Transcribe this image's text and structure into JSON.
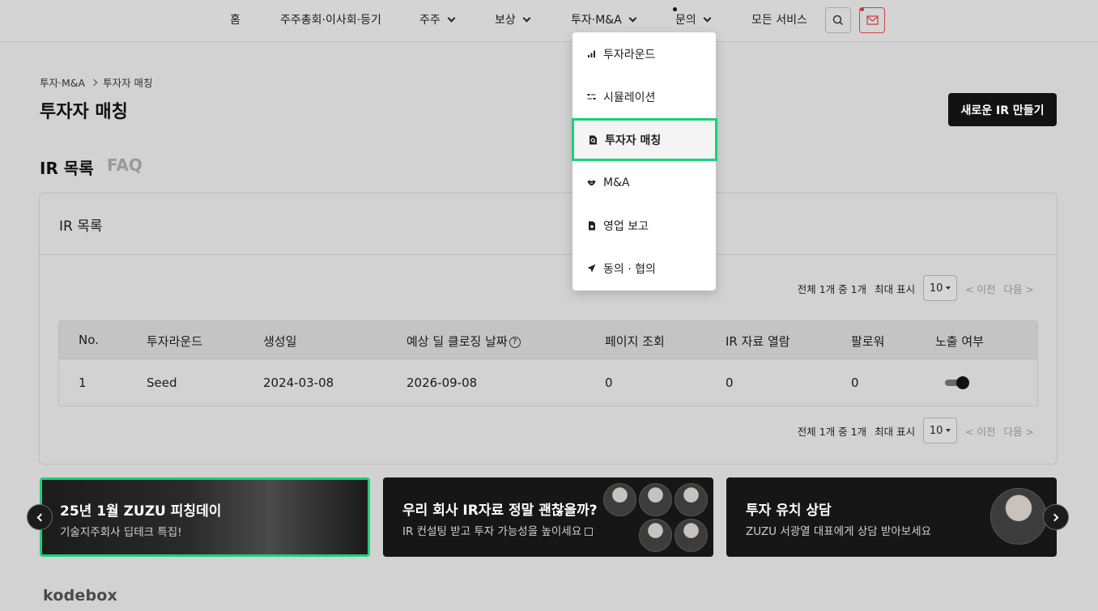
{
  "nav": {
    "items": [
      {
        "label": "홈"
      },
      {
        "label": "주주총회·이사회·등기"
      },
      {
        "label": "주주"
      },
      {
        "label": "보상"
      },
      {
        "label": "투자·M&A"
      },
      {
        "label": "문의"
      },
      {
        "label": "모든 서비스"
      }
    ],
    "search_icon": "search-icon",
    "mail_icon": "mail-icon"
  },
  "breadcrumb": {
    "parent": "투자·M&A",
    "current": "투자자 매칭"
  },
  "page_title": "투자자 매칭",
  "primary_button": "새로운 IR 만들기",
  "tabs": [
    {
      "label": "IR 목록"
    },
    {
      "label": "FAQ"
    }
  ],
  "card": {
    "title": "IR 목록",
    "pagination": {
      "summary": "전체 1개 중 1개",
      "max_label": "최대 표시",
      "page_size": "10",
      "prev": "< 이전",
      "next": "다음 >"
    },
    "table": {
      "columns": [
        "No.",
        "투자라운드",
        "생성일",
        "예상 딜 클로징 날짜",
        "페이지 조회",
        "IR 자료 열람",
        "팔로워",
        "노출 여부"
      ],
      "rows": [
        {
          "no": "1",
          "round": "Seed",
          "created": "2024-03-08",
          "closing": "2026-09-08",
          "views": "0",
          "ir_views": "0",
          "followers": "0",
          "exposed": true
        }
      ]
    }
  },
  "banners": [
    {
      "title": "25년 1월 ZUZU 피칭데이",
      "subtitle": "기술지주회사 딥테크 특집!"
    },
    {
      "title": "우리 회사 IR자료 정말 괜찮을까?",
      "subtitle": "IR 컨설팅 받고 투자 가능성을 높이세요"
    },
    {
      "title": "투자 유치 상담",
      "subtitle": "ZUZU 서광열 대표에게 상담 받아보세요"
    }
  ],
  "footer_logo": "kodebox",
  "dropdown": {
    "items": [
      {
        "label": "투자라운드",
        "icon": "bar-chart-icon"
      },
      {
        "label": "시뮬레이션",
        "icon": "sliders-icon"
      },
      {
        "label": "투자자 매칭",
        "icon": "document-search-icon",
        "active": true
      },
      {
        "label": "M&A",
        "icon": "handshake-icon"
      },
      {
        "label": "영업 보고",
        "icon": "report-icon"
      },
      {
        "label": "동의 · 협의",
        "icon": "send-icon"
      }
    ]
  },
  "colors": {
    "highlight": "#19d07a",
    "primary": "#121212",
    "overlay": "#d2d2d2"
  }
}
